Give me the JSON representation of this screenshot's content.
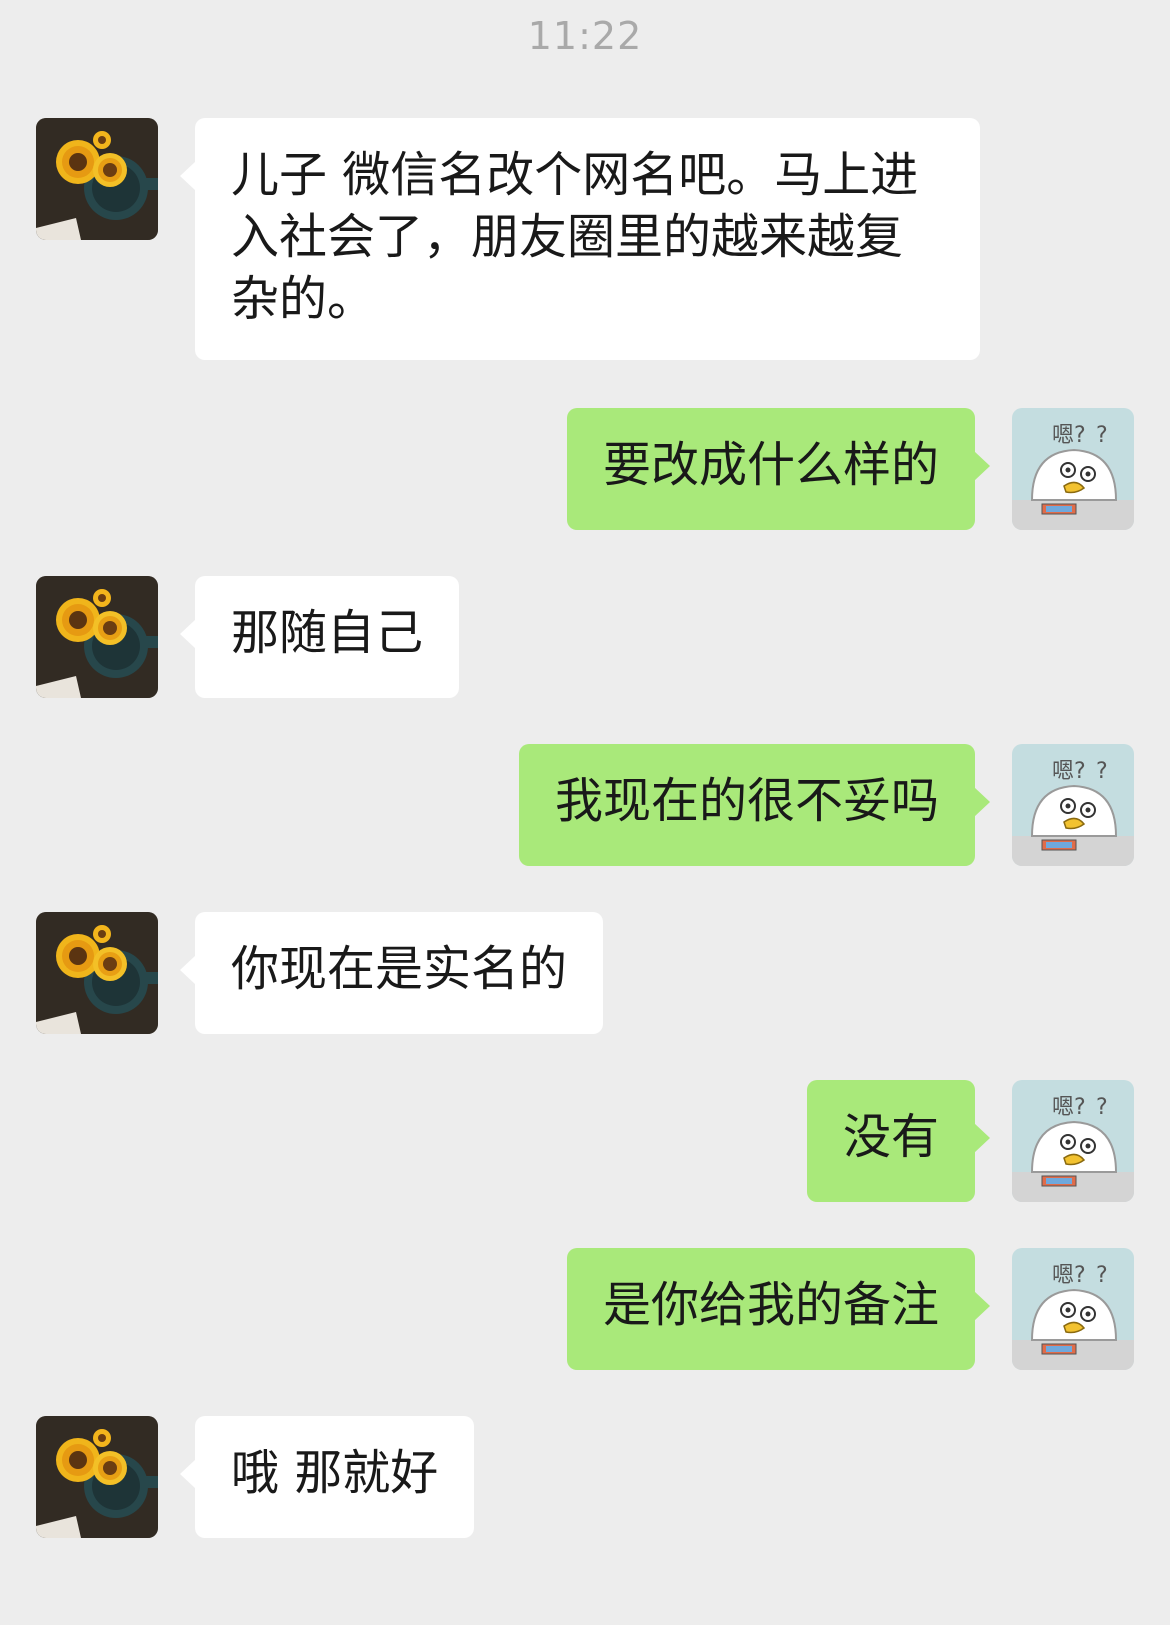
{
  "header": {
    "time": "11:22"
  },
  "messages": [
    {
      "side": "left",
      "text": "儿子 微信名改个网名吧。马上进入社会了，朋友圈里的越来越复杂的。"
    },
    {
      "side": "right",
      "text": "要改成什么样的"
    },
    {
      "side": "left",
      "text": "那随自己"
    },
    {
      "side": "right",
      "text": "我现在的很不妥吗"
    },
    {
      "side": "left",
      "text": "你现在是实名的"
    },
    {
      "side": "right",
      "text": "没有"
    },
    {
      "side": "right",
      "text": "是你给我的备注"
    },
    {
      "side": "left",
      "text": "哦 那就好"
    }
  ],
  "avatars": {
    "contact": {
      "icon": "sunflower-avatar-icon"
    },
    "me": {
      "icon": "duck-sticker-avatar-icon",
      "caption": "嗯?"
    }
  },
  "colors": {
    "background": "#ededed",
    "incoming_bubble": "#ffffff",
    "outgoing_bubble": "#a9e97a",
    "timestamp": "#a9a9a9"
  }
}
